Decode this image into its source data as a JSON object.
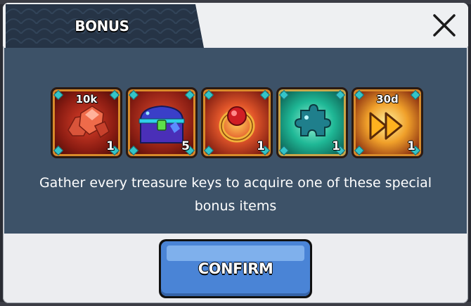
{
  "dialog": {
    "title": "BONUS",
    "description": "Gather every treasure keys to acquire one of these special bonus items",
    "confirm_label": "CONFIRM",
    "close_icon": "close-icon"
  },
  "items": [
    {
      "name": "ruby-gems",
      "top_label": "10k",
      "count": "1",
      "icon": "red-gem-icon"
    },
    {
      "name": "treasure-chest",
      "top_label": "",
      "count": "5",
      "icon": "blue-chest-icon"
    },
    {
      "name": "ring",
      "top_label": "",
      "count": "1",
      "icon": "ruby-ring-icon"
    },
    {
      "name": "puzzle-piece",
      "top_label": "",
      "count": "1",
      "icon": "puzzle-piece-icon"
    },
    {
      "name": "speed-boost",
      "top_label": "30d",
      "count": "1",
      "icon": "fast-forward-icon"
    }
  ],
  "colors": {
    "panel": "#3d5268",
    "title_tab": "#263446",
    "button": "#4a84d6",
    "item_frame": "#d88a2a",
    "teal_bg": "#16a58f"
  }
}
